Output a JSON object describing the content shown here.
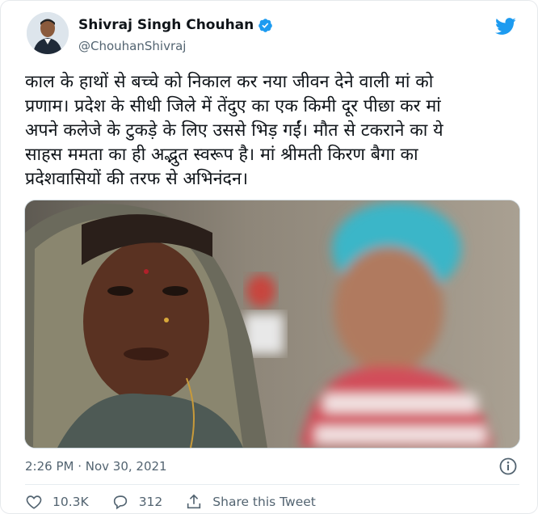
{
  "user": {
    "display_name": "Shivraj Singh Chouhan",
    "handle": "@ChouhanShivraj",
    "verified": true
  },
  "tweet": {
    "text_lines": [
      "काल के हाथों से बच्चे को निकाल कर नया जीवन देने वाली मां को",
      "प्रणाम। प्रदेश के सीधी जिले में तेंदुए का एक किमी दूर पीछा कर मां",
      "अपने कलेजे के टुकड़े के लिए उससे भिड़ गईं। मौत से टकराने का ये",
      "साहस ममता का ही अद्भुत स्वरूप है। मां श्रीमती किरण बैगा का",
      "प्रदेशवासियों की तरफ से अभिनंदन।"
    ],
    "timestamp": "2:26 PM · Nov 30, 2021"
  },
  "actions": {
    "likes": "10.3K",
    "replies": "312",
    "share_label": "Share this Tweet"
  },
  "icons": {
    "verified": "verified-badge-icon",
    "logo": "twitter-bird-icon",
    "info": "info-icon",
    "like": "heart-icon",
    "reply": "reply-bubble-icon",
    "share": "share-icon"
  },
  "colors": {
    "twitter_blue": "#1d9bf0",
    "text_primary": "#0f1419",
    "text_secondary": "#536471"
  }
}
